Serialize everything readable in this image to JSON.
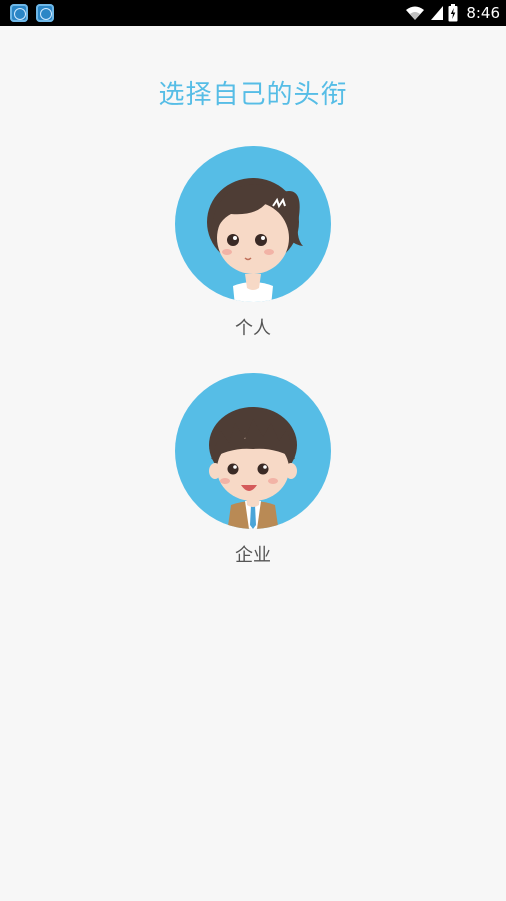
{
  "status_bar": {
    "time": "8:46",
    "apps": [
      "app-icon",
      "app-icon"
    ],
    "icons": [
      "wifi-icon",
      "signal-icon",
      "battery-icon"
    ]
  },
  "page": {
    "title": "选择自己的头衔"
  },
  "roles": [
    {
      "label": "个人",
      "icon": "female-avatar-icon"
    },
    {
      "label": "企业",
      "icon": "male-avatar-icon"
    }
  ],
  "colors": {
    "accent": "#56bde6",
    "background": "#f7f7f7",
    "label": "#555555"
  }
}
